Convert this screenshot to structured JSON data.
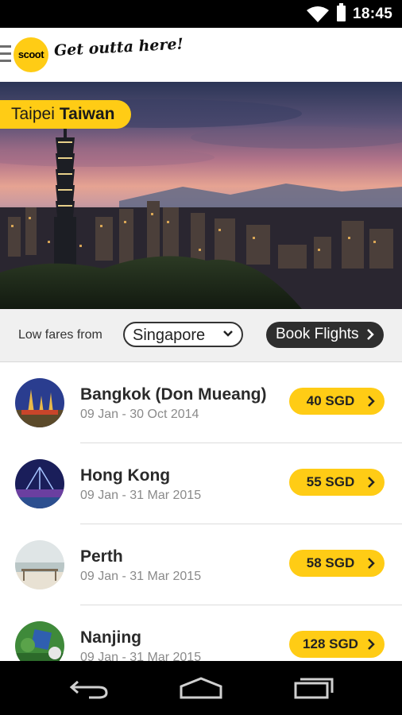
{
  "status_bar": {
    "time": "18:45"
  },
  "header": {
    "logo_text": "scoot",
    "tagline": "Get outta here!"
  },
  "hero": {
    "city": "Taipei",
    "country": "Taiwan"
  },
  "fare_bar": {
    "label": "Low fares from",
    "origin": "Singapore",
    "book_label": "Book Flights"
  },
  "destinations": [
    {
      "name": "Bangkok (Don Mueang)",
      "dates": "09 Jan - 30 Oct 2014",
      "price": "40 SGD"
    },
    {
      "name": "Hong Kong",
      "dates": "09 Jan - 31 Mar 2015",
      "price": "55 SGD"
    },
    {
      "name": "Perth",
      "dates": "09 Jan - 31 Mar 2015",
      "price": "58 SGD"
    },
    {
      "name": "Nanjing",
      "dates": "09 Jan - 31 Mar 2015",
      "price": "128 SGD"
    }
  ],
  "colors": {
    "brand_yellow": "#ffcc15",
    "dark": "#2e2e2e",
    "light_bg": "#f0f0f0"
  },
  "icons": [
    "wifi-icon",
    "battery-icon",
    "menu-icon",
    "chevron-down-icon",
    "chevron-right-icon",
    "back-icon",
    "home-icon",
    "recent-apps-icon"
  ]
}
